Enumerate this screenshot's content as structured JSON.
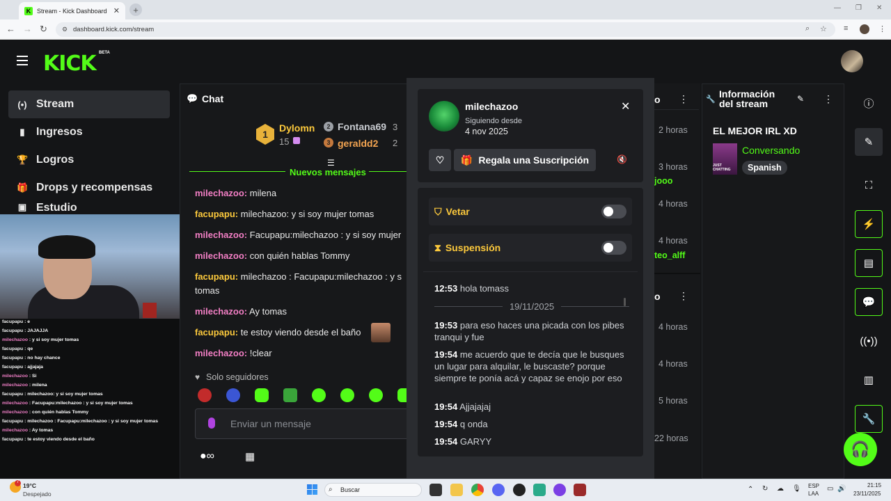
{
  "browser": {
    "tab_title": "Stream - Kick Dashboard",
    "tab_favicon": "K",
    "url": "dashboard.kick.com/stream"
  },
  "header": {
    "logo": "KICK",
    "beta": "BETA"
  },
  "sidebar": {
    "items": [
      {
        "label": "Stream",
        "icon": "stream-icon",
        "glyph": "(•)"
      },
      {
        "label": "Ingresos",
        "icon": "chart-icon",
        "glyph": "▮"
      },
      {
        "label": "Logros",
        "icon": "trophy-icon",
        "glyph": "🏆"
      },
      {
        "label": "Drops y recompensas",
        "icon": "gift-icon",
        "glyph": "🎁"
      },
      {
        "label": "Estudio",
        "icon": "studio-icon",
        "glyph": "▣"
      }
    ]
  },
  "overlay_chat": [
    {
      "user": "facupapu",
      "text": " : e",
      "kind": "f"
    },
    {
      "user": "facupapu",
      "text": " : JAJAJJA",
      "kind": "f"
    },
    {
      "user": "milechazoo",
      "text": " : y si soy mujer tomas",
      "kind": "u"
    },
    {
      "user": "facupapu",
      "text": " : qe",
      "kind": "f"
    },
    {
      "user": "facupapu",
      "text": " : no hay chance",
      "kind": "f"
    },
    {
      "user": "facupapu",
      "text": " : ajjajaja",
      "kind": "f"
    },
    {
      "user": "milechazoo",
      "text": " : Si",
      "kind": "u"
    },
    {
      "user": "milechazoo",
      "text": " : milena",
      "kind": "u"
    },
    {
      "user": "facupapu",
      "text": " : milechazoo: y si soy mujer tomas",
      "kind": "f"
    },
    {
      "user": "milechazoo",
      "text": " : Facupapu:milechazoo : y si soy mujer tomas",
      "kind": "u"
    },
    {
      "user": "milechazoo",
      "text": " : con quién hablas Tommy",
      "kind": "u"
    },
    {
      "user": "facupapu",
      "text": " : milechazoo : Facupapu:milechazoo : y si soy mujer tomas",
      "kind": "f"
    },
    {
      "user": "milechazoo",
      "text": " : Ay tomas",
      "kind": "u"
    },
    {
      "user": "facupapu",
      "text": " : te estoy viendo desde el baño",
      "kind": "f"
    }
  ],
  "chat": {
    "title": "Chat",
    "leaders": [
      {
        "rank": "1",
        "name": "Dylomn",
        "count": "15"
      },
      {
        "rank": "2",
        "name": "Fontana69",
        "count": "3"
      },
      {
        "rank": "3",
        "name": "geraldd2",
        "count": "2"
      }
    ],
    "new_messages": "Nuevos mensajes",
    "messages": [
      {
        "user": "milechazoo",
        "text": " milena",
        "color": "pink"
      },
      {
        "user": "facupapu",
        "text": " milechazoo: y si soy mujer tomas",
        "color": "yel"
      },
      {
        "user": "milechazoo",
        "text": " Facupapu:milechazoo : y si soy mujer",
        "color": "pink"
      },
      {
        "user": "milechazoo",
        "text": " con quién hablas Tommy",
        "color": "pink"
      },
      {
        "user": "facupapu",
        "text": " milechazoo : Facupapu:milechazoo : y s",
        "color": "yel"
      },
      {
        "user": "",
        "text": "tomas",
        "color": "yel"
      },
      {
        "user": "milechazoo",
        "text": " Ay tomas",
        "color": "pink"
      },
      {
        "user": "facupapu",
        "text": " te estoy viendo desde el baño",
        "color": "yel"
      },
      {
        "user": "milechazoo",
        "text": " !clear",
        "color": "pink"
      }
    ],
    "followers_only": "Solo seguidores",
    "input_placeholder": "Enviar un mensaje"
  },
  "mid_column": {
    "top_times": [
      "2 horas",
      "3 horas",
      "4 horas",
      "4 horas"
    ],
    "top_names": [
      "jooo",
      "teo_alff"
    ],
    "bottom_title": "o",
    "bottom_times": [
      "4 horas",
      "4 horas",
      "5 horas",
      "22 horas"
    ]
  },
  "stream_info": {
    "title": "Información del stream",
    "stream_title": "EL MEJOR IRL XD",
    "category": "Conversando",
    "thumb_label": "JUST CHATTING",
    "language": "Spanish"
  },
  "user_card": {
    "username": "milechazoo",
    "following_since_label": "Siguiendo desde",
    "following_since_date": "4 nov 2025",
    "gift_label": "Regala una Suscripción",
    "ban_label": "Vetar",
    "timeout_label": "Suspensión",
    "history": [
      {
        "time": "12:53",
        "text": "hola tomass"
      },
      {
        "date": "19/11/2025"
      },
      {
        "time": "19:53",
        "text": "para eso haces una picada con los pibes tranqui y fue"
      },
      {
        "time": "19:54",
        "text": "me acuerdo que te decía que le busques un lugar para alquilar, le buscaste? porque siempre te ponía acá y capaz se enojo por eso"
      },
      {
        "time": "19:54",
        "text": "Ajjajajaj"
      },
      {
        "time": "19:54",
        "text": "q onda"
      },
      {
        "time": "19:54",
        "text": "GARYY"
      }
    ]
  },
  "taskbar": {
    "weather_temp": "19°C",
    "weather_desc": "Despejado",
    "search_placeholder": "Buscar",
    "lang1": "ESP",
    "lang2": "LAA",
    "time": "21:15",
    "date": "23/11/2025"
  },
  "colors": {
    "accent": "#53fc18",
    "pink": "#f37fc5",
    "gold": "#fcc93c"
  }
}
